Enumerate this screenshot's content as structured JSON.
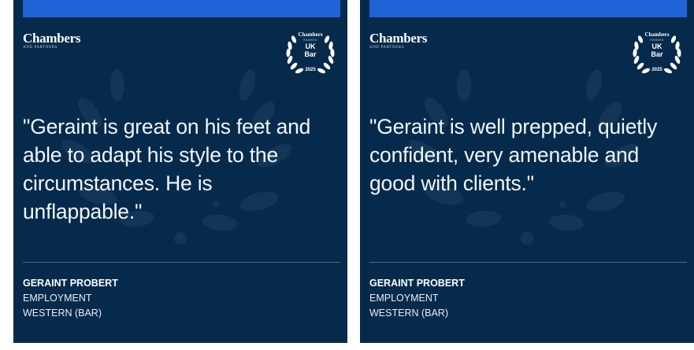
{
  "colors": {
    "card_background": "#052a4c",
    "accent_bar": "#1f63d6",
    "text": "#ffffff"
  },
  "cards": [
    {
      "brand": {
        "name": "Chambers",
        "sub": "AND PARTNERS"
      },
      "badge": {
        "brand": "Chambers",
        "ranked": "RANKED",
        "line1": "UK",
        "line2": "Bar",
        "year": "2025",
        "icon": "laurel-wreath-icon"
      },
      "quote": "\"Geraint is great on his feet and able to adapt his style to the circumstances. He is unflappable.\"",
      "attribution": {
        "name": "GERAINT PROBERT",
        "practice": "EMPLOYMENT",
        "region": "WESTERN (BAR)"
      }
    },
    {
      "brand": {
        "name": "Chambers",
        "sub": "AND PARTNERS"
      },
      "badge": {
        "brand": "Chambers",
        "ranked": "RANKED",
        "line1": "UK",
        "line2": "Bar",
        "year": "2025",
        "icon": "laurel-wreath-icon"
      },
      "quote": "\"Geraint is well prepped, quietly confident, very amenable and good with clients.\"",
      "attribution": {
        "name": "GERAINT PROBERT",
        "practice": "EMPLOYMENT",
        "region": "WESTERN (BAR)"
      }
    }
  ]
}
